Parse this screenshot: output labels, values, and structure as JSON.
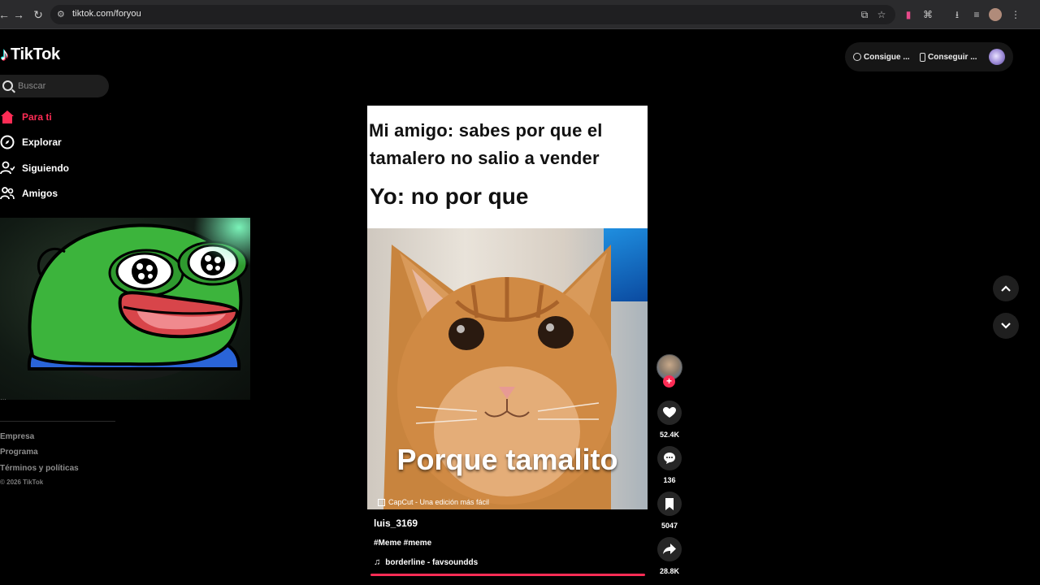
{
  "browser": {
    "url": "tiktok.com/foryou"
  },
  "app": {
    "logo_text": "TikTok"
  },
  "search": {
    "placeholder": "Buscar"
  },
  "sidebar": {
    "items": [
      {
        "label": "Para ti",
        "icon": "home-icon",
        "active": true
      },
      {
        "label": "Explorar",
        "icon": "compass-icon"
      },
      {
        "label": "Siguiendo",
        "icon": "following-icon"
      },
      {
        "label": "Amigos",
        "icon": "friends-icon"
      }
    ],
    "footer": {
      "links": [
        "Empresa",
        "Programa",
        "Términos y políticas"
      ],
      "copyright": "© 2026 TikTok"
    }
  },
  "header_actions": {
    "coins_label": "Consigue ...",
    "app_label": "Conseguir ..."
  },
  "video": {
    "meme_line1": "Mi amigo: sabes por que el",
    "meme_line2": "tamalero no salio a vender",
    "meme_line3": "Yo: no por que",
    "caption": "Porque tamalito",
    "watermark": "CapCut - Una edición más fácil",
    "author": "luis_3169",
    "hashtags": "#Meme #meme",
    "music": "borderline - favsoundds",
    "progress": 1.0
  },
  "actions": {
    "likes": "52.4K",
    "comments": "136",
    "saves": "5047",
    "shares": "28.8K"
  },
  "colors": {
    "accent": "#fe2c55",
    "background": "#000000"
  }
}
